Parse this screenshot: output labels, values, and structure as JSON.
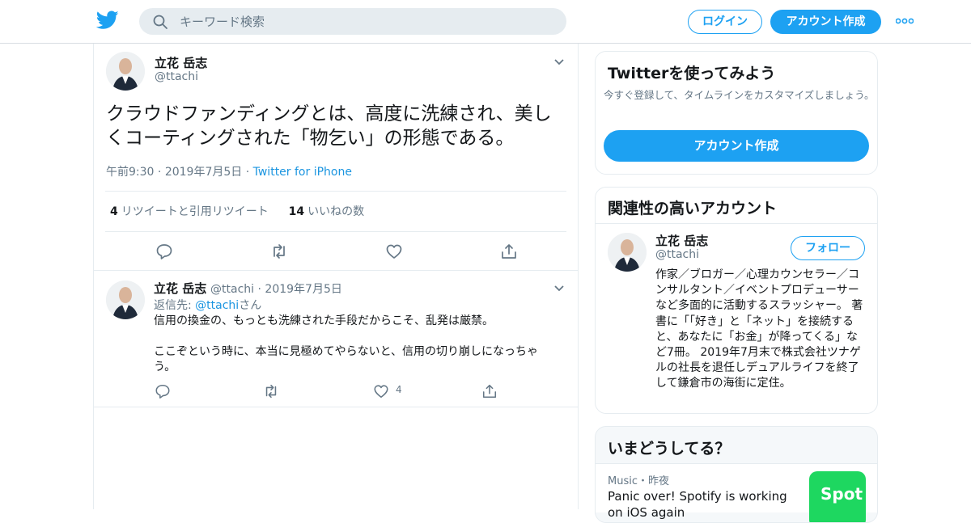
{
  "header": {
    "search_placeholder": "キーワード検索",
    "login_label": "ログイン",
    "signup_label": "アカウント作成",
    "brand_color": "#1da1f2"
  },
  "tweet": {
    "author_name": "立花 岳志",
    "author_handle": "@ttachi",
    "text": "クラウドファンディングとは、高度に洗練され、美しくコーティングされた「物乞い」の形態である。",
    "time": "午前9:30",
    "date": "2019年7月5日",
    "source": "Twitter for iPhone",
    "retweets_count": "4",
    "retweets_label": "リツイートと引用リツイート",
    "likes_count": "14",
    "likes_label": "いいねの数"
  },
  "reply": {
    "author_name": "立花 岳志",
    "author_handle": "@ttachi",
    "date": "2019年7月5日",
    "reply_prefix": "返信先: ",
    "reply_handle": "@ttachi",
    "reply_suffix": "さん",
    "line1": "信用の換金の、もっとも洗練された手段だからこそ、乱発は厳禁。",
    "line2": "ここぞという時に、本当に見極めてやらないと、信用の切り崩しになっちゃう。",
    "like_count": "4"
  },
  "sidebar": {
    "try_title": "Twitterを使ってみよう",
    "try_sub": "今すぐ登録して、タイムラインをカスタマイズしましょう。",
    "try_button": "アカウント作成",
    "related_title": "関連性の高いアカウント",
    "related_name": "立花 岳志",
    "related_handle": "@ttachi",
    "follow_label": "フォロー",
    "related_bio": "作家／ブロガー／心理カウンセラー／コンサルタント／イベントプロデューサーなど多面的に活動するスラッシャー。 著書に「「好き」と「ネット」を接続すると、あなたに「お金」が降ってくる」など7冊。 2019年7月末で株式会社ツナゲルの社長を退任しデュアルライフを終了して鎌倉市の海街に定住。",
    "trends_title": "いまどうしてる？",
    "trend_category": "Music・昨夜",
    "trend_headline": "Panic over! Spotify is working on iOS again",
    "trend_image_text": "Spot"
  }
}
